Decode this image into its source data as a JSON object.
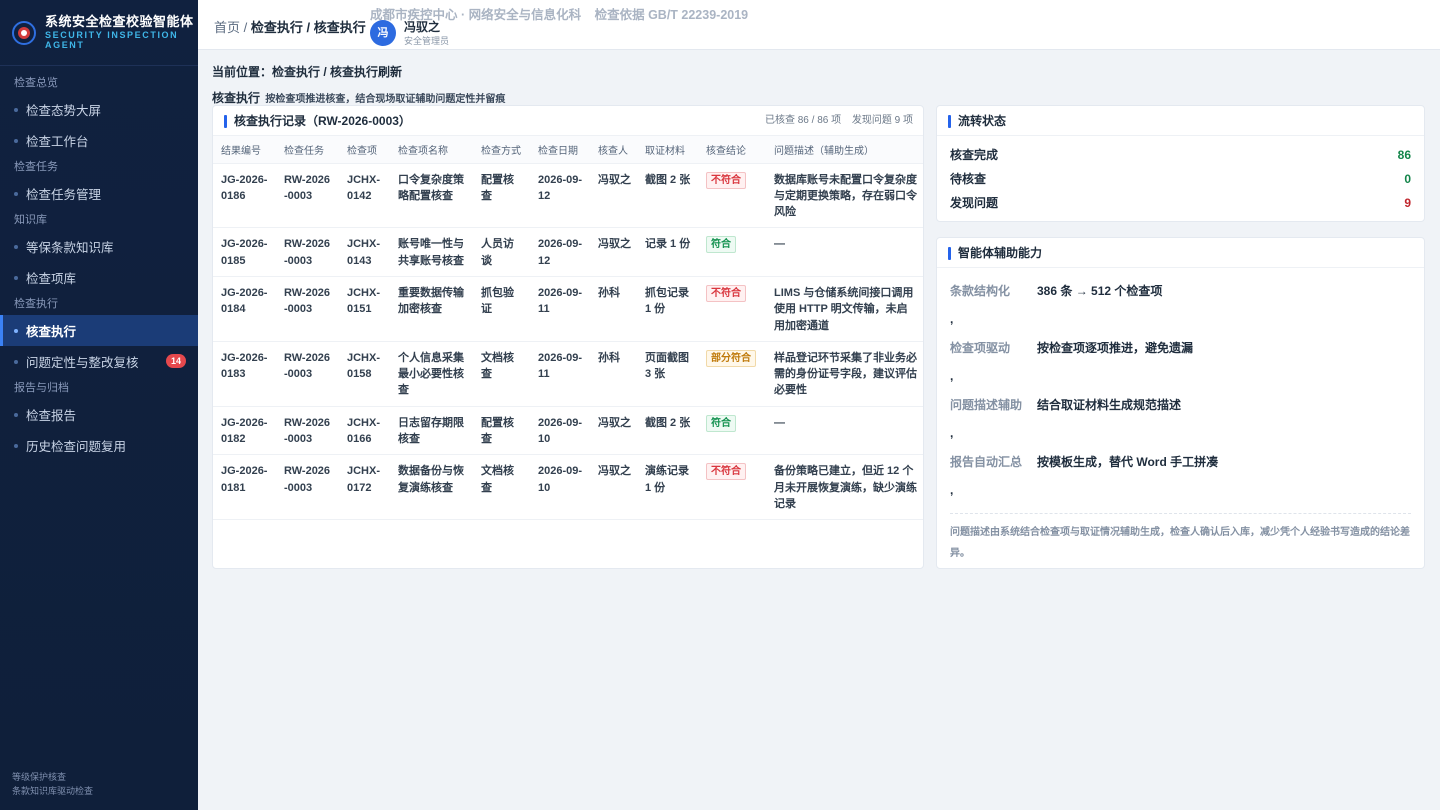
{
  "brand": {
    "title": "系统安全检查校验智能体",
    "subtitle_line1": "SECURITY INSPECTION",
    "subtitle_line2": "AGENT"
  },
  "sidebar": {
    "groups": [
      {
        "label": "检查总览",
        "items": [
          {
            "label": "检查态势大屏"
          },
          {
            "label": "检查工作台"
          }
        ]
      },
      {
        "label": "检查任务",
        "items": [
          {
            "label": "检查任务管理"
          }
        ]
      },
      {
        "label": "知识库",
        "items": [
          {
            "label": "等保条款知识库"
          },
          {
            "label": "检查项库"
          }
        ]
      },
      {
        "label": "检查执行",
        "items": [
          {
            "label": "核查执行",
            "active": true
          },
          {
            "label": "问题定性与整改复核",
            "badge": "14"
          }
        ]
      },
      {
        "label": "报告与归档",
        "items": [
          {
            "label": "检查报告"
          },
          {
            "label": "历史检查问题复用"
          }
        ]
      }
    ],
    "footer_line1": "等级保护核查",
    "footer_line2": "条款知识库驱动检查"
  },
  "header": {
    "crumb_home": "首页",
    "crumb_sep": " / ",
    "crumb_path": "检查执行 / 核查执行",
    "org": "成都市疾控中心 · 网络安全与信息化科",
    "basis": "检查依据 GB/T 22239-2019",
    "user_avatar": "冯",
    "user_name": "冯驭之",
    "user_role": "安全管理员"
  },
  "main": {
    "location": "当前位置：检查执行 / 核查执行刷新",
    "page_title": "核查执行",
    "page_desc": "按检查项推进核查，结合现场取证辅助问题定性并留痕"
  },
  "records": {
    "title": "核查执行记录（RW-2026-0003）",
    "stat_checked": "已核查 86 / 86 项",
    "stat_issues": "发现问题 9 项",
    "columns": [
      "结果编号",
      "检查任务",
      "检查项",
      "检查项名称",
      "检查方式",
      "检查日期",
      "核查人",
      "取证材料",
      "核查结论",
      "问题描述（辅助生成）"
    ],
    "rows": [
      {
        "id": "JG-2026-0186",
        "task": "RW-2026-0003",
        "item": "JCHX-0142",
        "name": "口令复杂度策略配置核查",
        "method": "配置核查",
        "date": "2026-09-12",
        "checker": "冯驭之",
        "evidence": "截图 2 张",
        "result": "不符合",
        "result_type": "bad",
        "desc": "数据库账号未配置口令复杂度与定期更换策略，存在弱口令风险"
      },
      {
        "id": "JG-2026-0185",
        "task": "RW-2026-0003",
        "item": "JCHX-0143",
        "name": "账号唯一性与共享账号核查",
        "method": "人员访谈",
        "date": "2026-09-12",
        "checker": "冯驭之",
        "evidence": "记录 1 份",
        "result": "符合",
        "result_type": "ok",
        "desc": "—"
      },
      {
        "id": "JG-2026-0184",
        "task": "RW-2026-0003",
        "item": "JCHX-0151",
        "name": "重要数据传输加密核查",
        "method": "抓包验证",
        "date": "2026-09-11",
        "checker": "孙科",
        "evidence": "抓包记录 1 份",
        "result": "不符合",
        "result_type": "bad",
        "desc": "LIMS 与仓储系统间接口调用使用 HTTP 明文传输，未启用加密通道"
      },
      {
        "id": "JG-2026-0183",
        "task": "RW-2026-0003",
        "item": "JCHX-0158",
        "name": "个人信息采集最小必要性核查",
        "method": "文档核查",
        "date": "2026-09-11",
        "checker": "孙科",
        "evidence": "页面截图 3 张",
        "result": "部分符合",
        "result_type": "part",
        "desc": "样品登记环节采集了非业务必需的身份证号字段，建议评估必要性"
      },
      {
        "id": "JG-2026-0182",
        "task": "RW-2026-0003",
        "item": "JCHX-0166",
        "name": "日志留存期限核查",
        "method": "配置核查",
        "date": "2026-09-10",
        "checker": "冯驭之",
        "evidence": "截图 2 张",
        "result": "符合",
        "result_type": "ok",
        "desc": "—"
      },
      {
        "id": "JG-2026-0181",
        "task": "RW-2026-0003",
        "item": "JCHX-0172",
        "name": "数据备份与恢复演练核查",
        "method": "文档核查",
        "date": "2026-09-10",
        "checker": "冯驭之",
        "evidence": "演练记录 1 份",
        "result": "不符合",
        "result_type": "bad",
        "desc": "备份策略已建立，但近 12 个月未开展恢复演练，缺少演练记录"
      }
    ]
  },
  "flow": {
    "title": "流转状态",
    "rows": [
      {
        "label": "核查完成",
        "value": "86",
        "color": "#13854a"
      },
      {
        "label": "待核查",
        "value": "0",
        "color": "#13854a"
      },
      {
        "label": "发现问题",
        "value": "9",
        "color": "#c0262d"
      }
    ]
  },
  "capability": {
    "title": "智能体辅助能力",
    "rows": [
      {
        "label": "条款结构化",
        "value": "386 条 → 512 个检查项"
      },
      {
        "label": "检查项驱动",
        "value": "按检查项逐项推进，避免遗漏"
      },
      {
        "label": "问题描述辅助",
        "value": "结合取证材料生成规范描述"
      },
      {
        "label": "报告自动汇总",
        "value": "按模板生成，替代 Word 手工拼凑"
      }
    ],
    "separator": ",",
    "note": "问题描述由系统结合检查项与取证情况辅助生成，检查人确认后入库，减少凭个人经验书写造成的结论差异。"
  }
}
